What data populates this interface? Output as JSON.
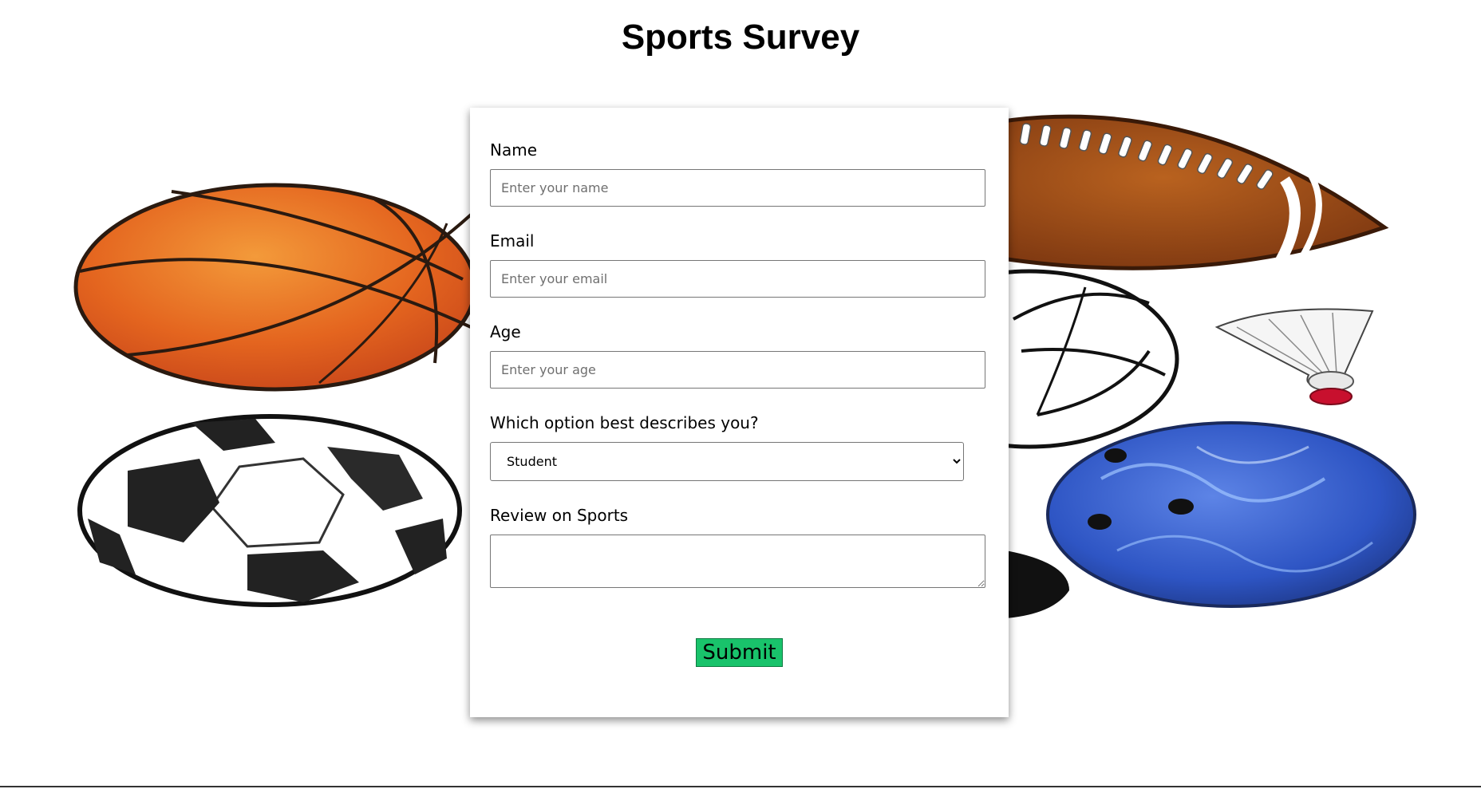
{
  "page": {
    "title": "Sports Survey"
  },
  "form": {
    "name": {
      "label": "Name",
      "placeholder": "Enter your name",
      "value": ""
    },
    "email": {
      "label": "Email",
      "placeholder": "Enter your email",
      "value": ""
    },
    "age": {
      "label": "Age",
      "placeholder": "Enter your age",
      "value": ""
    },
    "role": {
      "label": "Which option best describes you?",
      "selected": "Student"
    },
    "review": {
      "label": "Review on Sports",
      "value": ""
    },
    "submit_label": "Submit"
  },
  "background": {
    "images": [
      "basketball",
      "soccer-ball",
      "american-football",
      "volleyball",
      "shuttlecock",
      "bowling-ball",
      "hockey-puck"
    ]
  },
  "colors": {
    "submit_bg": "#19c36b",
    "card_bg": "#ffffff",
    "basketball": "#e0631f",
    "football": "#9a4a14",
    "bowling": "#2f58c8"
  }
}
